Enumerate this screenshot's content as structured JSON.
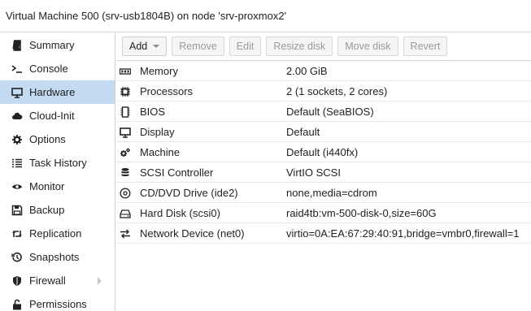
{
  "window": {
    "title": "Virtual Machine 500 (srv-usb1804B) on node 'srv-proxmox2'"
  },
  "sidebar": {
    "items": [
      {
        "label": "Summary",
        "icon": "book-icon"
      },
      {
        "label": "Console",
        "icon": "terminal-icon"
      },
      {
        "label": "Hardware",
        "icon": "monitor-icon",
        "active": true
      },
      {
        "label": "Cloud-Init",
        "icon": "cloud-icon"
      },
      {
        "label": "Options",
        "icon": "gear-icon"
      },
      {
        "label": "Task History",
        "icon": "list-icon"
      },
      {
        "label": "Monitor",
        "icon": "eye-icon"
      },
      {
        "label": "Backup",
        "icon": "floppy-icon"
      },
      {
        "label": "Replication",
        "icon": "retweet-icon"
      },
      {
        "label": "Snapshots",
        "icon": "history-icon"
      },
      {
        "label": "Firewall",
        "icon": "shield-icon"
      },
      {
        "label": "Permissions",
        "icon": "unlock-icon"
      }
    ]
  },
  "toolbar": {
    "add": "Add",
    "remove": "Remove",
    "edit": "Edit",
    "resize": "Resize disk",
    "move": "Move disk",
    "revert": "Revert"
  },
  "hardware": {
    "rows": [
      {
        "label": "Memory",
        "value": "2.00 GiB",
        "icon": "memory-icon"
      },
      {
        "label": "Processors",
        "value": "2 (1 sockets, 2 cores)",
        "icon": "cpu-icon"
      },
      {
        "label": "BIOS",
        "value": "Default (SeaBIOS)",
        "icon": "microchip-icon"
      },
      {
        "label": "Display",
        "value": "Default",
        "icon": "desktop-icon"
      },
      {
        "label": "Machine",
        "value": "Default (i440fx)",
        "icon": "cogs-icon"
      },
      {
        "label": "SCSI Controller",
        "value": "VirtIO SCSI",
        "icon": "database-icon"
      },
      {
        "label": "CD/DVD Drive (ide2)",
        "value": "none,media=cdrom",
        "icon": "cdrom-icon"
      },
      {
        "label": "Hard Disk (scsi0)",
        "value": "raid4tb:vm-500-disk-0,size=60G",
        "icon": "hdd-icon"
      },
      {
        "label": "Network Device (net0)",
        "value": "virtio=0A:EA:67:29:40:91,bridge=vmbr0,firewall=1",
        "icon": "exchange-icon"
      }
    ]
  },
  "colors": {
    "active_nav": "#c3daf0",
    "border": "#d6d6d6"
  }
}
